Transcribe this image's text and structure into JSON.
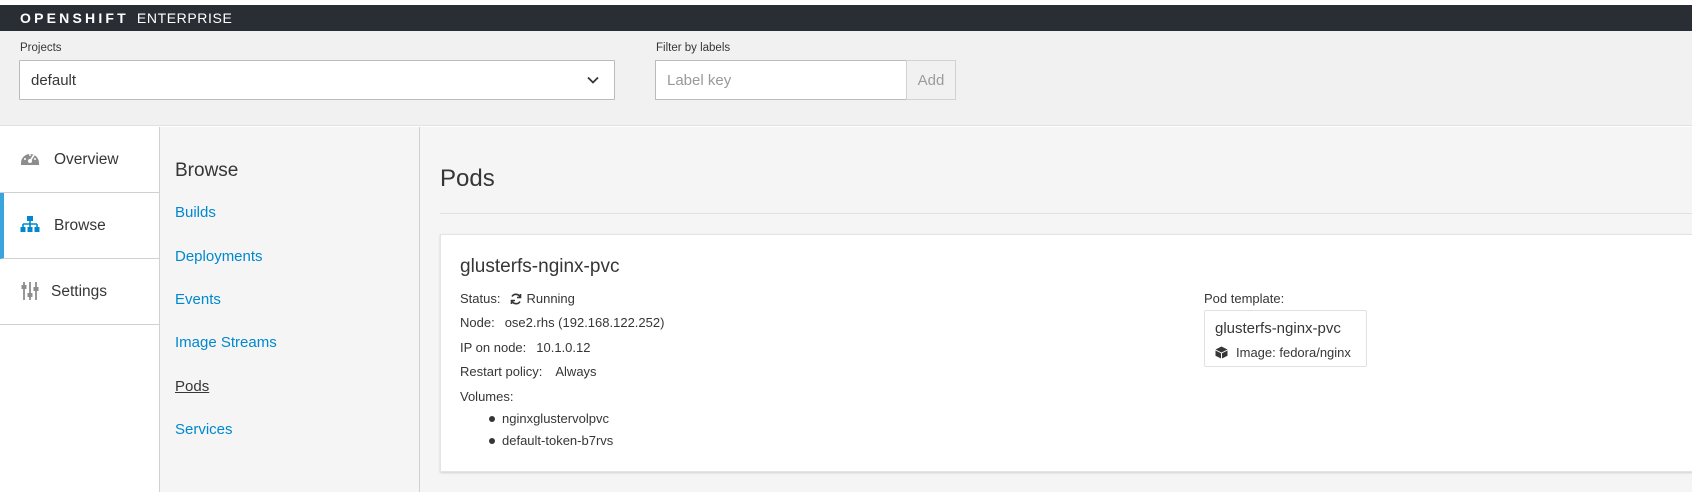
{
  "navbar": {
    "brand_strong": "OPENSHIFT",
    "brand_light": "ENTERPRISE"
  },
  "toolbar": {
    "projects_label": "Projects",
    "project_selected": "default",
    "filter_label": "Filter by labels",
    "filter_placeholder": "Label key",
    "add_label": "Add"
  },
  "sidebar": {
    "items": [
      {
        "label": "Overview",
        "icon": "dashboard-icon"
      },
      {
        "label": "Browse",
        "icon": "sitemap-icon",
        "active": true
      },
      {
        "label": "Settings",
        "icon": "sliders-icon"
      }
    ]
  },
  "browse": {
    "title": "Browse",
    "links": [
      "Builds",
      "Deployments",
      "Events",
      "Image Streams",
      "Pods",
      "Services"
    ],
    "current": "Pods"
  },
  "main": {
    "title": "Pods",
    "pod": {
      "name": "glusterfs-nginx-pvc",
      "status_key": "Status:",
      "status_value": "Running",
      "node_key": "Node:",
      "node_value": "ose2.rhs (192.168.122.252)",
      "ip_key": "IP on node:",
      "ip_value": "10.1.0.12",
      "restart_key": "Restart policy:",
      "restart_value": "Always",
      "volumes_key": "Volumes:",
      "volumes": [
        "nginxglustervolpvc",
        "default-token-b7rvs"
      ],
      "template_label": "Pod template:",
      "template_name": "glusterfs-nginx-pvc",
      "template_image": "Image: fedora/nginx"
    }
  },
  "colors": {
    "navbar": "#292e34",
    "link": "#0088ce",
    "active_accent": "#39a5dc"
  }
}
